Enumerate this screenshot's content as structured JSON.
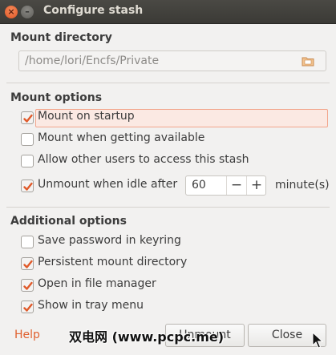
{
  "window": {
    "title": "Configure stash",
    "close_glyph": "×",
    "minimize_glyph": "–"
  },
  "mount_directory": {
    "heading": "Mount directory",
    "path": "/home/lori/Encfs/Private",
    "icon": "folder-icon"
  },
  "mount_options": {
    "heading": "Mount options",
    "items": [
      {
        "label": "Mount on startup",
        "checked": true
      },
      {
        "label": "Mount when getting available",
        "checked": false
      },
      {
        "label": "Allow other users to access this stash",
        "checked": false
      },
      {
        "label": "Unmount when idle after",
        "checked": true
      }
    ],
    "idle_value": "60",
    "minus": "−",
    "plus": "+",
    "unit": "minute(s)"
  },
  "additional_options": {
    "heading": "Additional options",
    "items": [
      {
        "label": "Save password in keyring",
        "checked": false
      },
      {
        "label": "Persistent mount directory",
        "checked": true
      },
      {
        "label": "Open in file manager",
        "checked": true
      },
      {
        "label": "Show in tray menu",
        "checked": true
      }
    ]
  },
  "footer": {
    "help": "Help",
    "unmount_label": "Unmount",
    "close_label": "Close"
  },
  "watermark": "双电网 (www.pcpc.me)",
  "colors": {
    "accent": "#e0602f",
    "checkbox_check": "#e05a2a",
    "highlight_bg": "#fbe9e3"
  }
}
